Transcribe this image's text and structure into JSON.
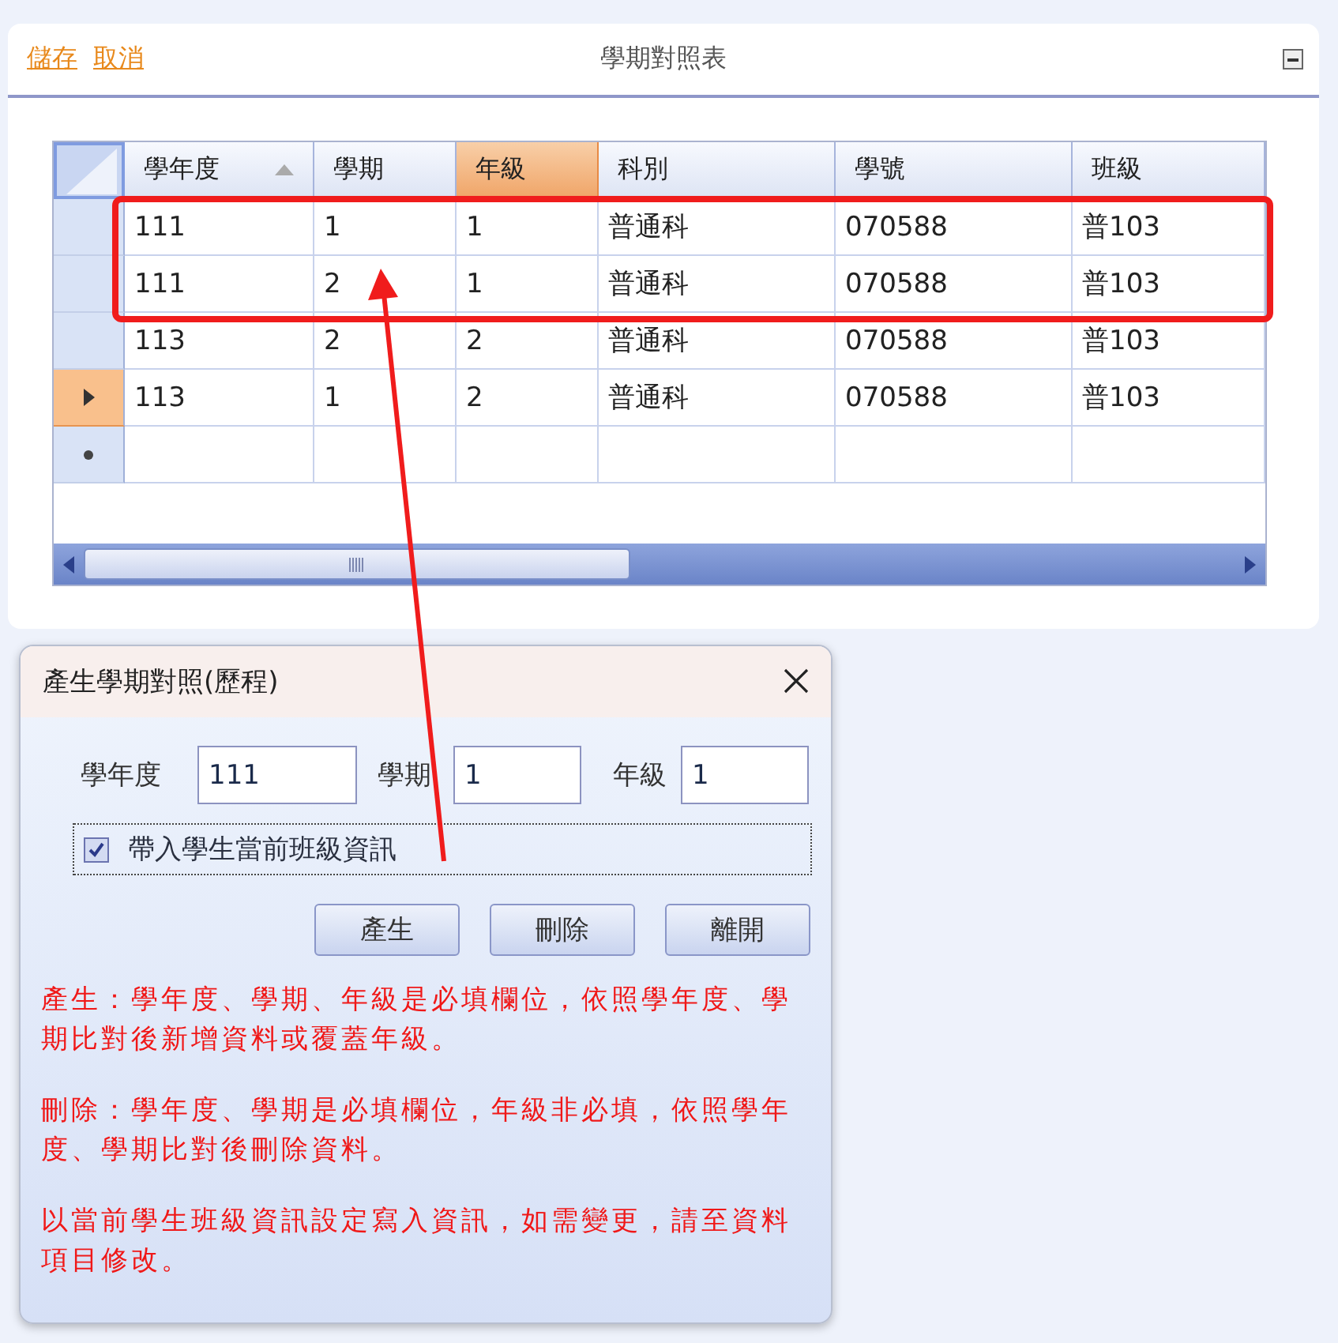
{
  "toolbar": {
    "links": [
      "儲存",
      "取消"
    ],
    "title": "學期對照表"
  },
  "grid": {
    "columns": [
      {
        "label": "學年度",
        "sorted": true,
        "selected": false
      },
      {
        "label": "學期",
        "sorted": false,
        "selected": false
      },
      {
        "label": "年級",
        "sorted": false,
        "selected": true
      },
      {
        "label": "科別",
        "sorted": false,
        "selected": false
      },
      {
        "label": "學號",
        "sorted": false,
        "selected": false
      },
      {
        "label": "班級",
        "sorted": false,
        "selected": false
      }
    ],
    "rows": [
      {
        "selected": false,
        "cells": [
          "111",
          "1",
          "1",
          "普通科",
          "070588",
          "普103"
        ]
      },
      {
        "selected": false,
        "cells": [
          "111",
          "2",
          "1",
          "普通科",
          "070588",
          "普103"
        ]
      },
      {
        "selected": false,
        "cells": [
          "113",
          "2",
          "2",
          "普通科",
          "070588",
          "普103"
        ]
      },
      {
        "selected": true,
        "cells": [
          "113",
          "1",
          "2",
          "普通科",
          "070588",
          "普103"
        ]
      }
    ]
  },
  "dialog": {
    "title": "產生學期對照(歷程)",
    "fields": [
      {
        "label": "學年度",
        "value": "111"
      },
      {
        "label": "學期",
        "value": "1"
      },
      {
        "label": "年級",
        "value": "1"
      }
    ],
    "checkbox": {
      "label": "帶入學生當前班級資訊",
      "checked": true
    },
    "buttons": [
      "產生",
      "刪除",
      "離開"
    ],
    "notes": [
      "產生：學年度、學期、年級是必填欄位，依照學年度、學期比對後新增資料或覆蓋年級。",
      "刪除：學年度、學期是必填欄位，年級非必填，依照學年度、學期比對後刪除資料。",
      "以當前學生班級資訊設定寫入資訊，如需變更，請至資料項目修改。"
    ]
  }
}
